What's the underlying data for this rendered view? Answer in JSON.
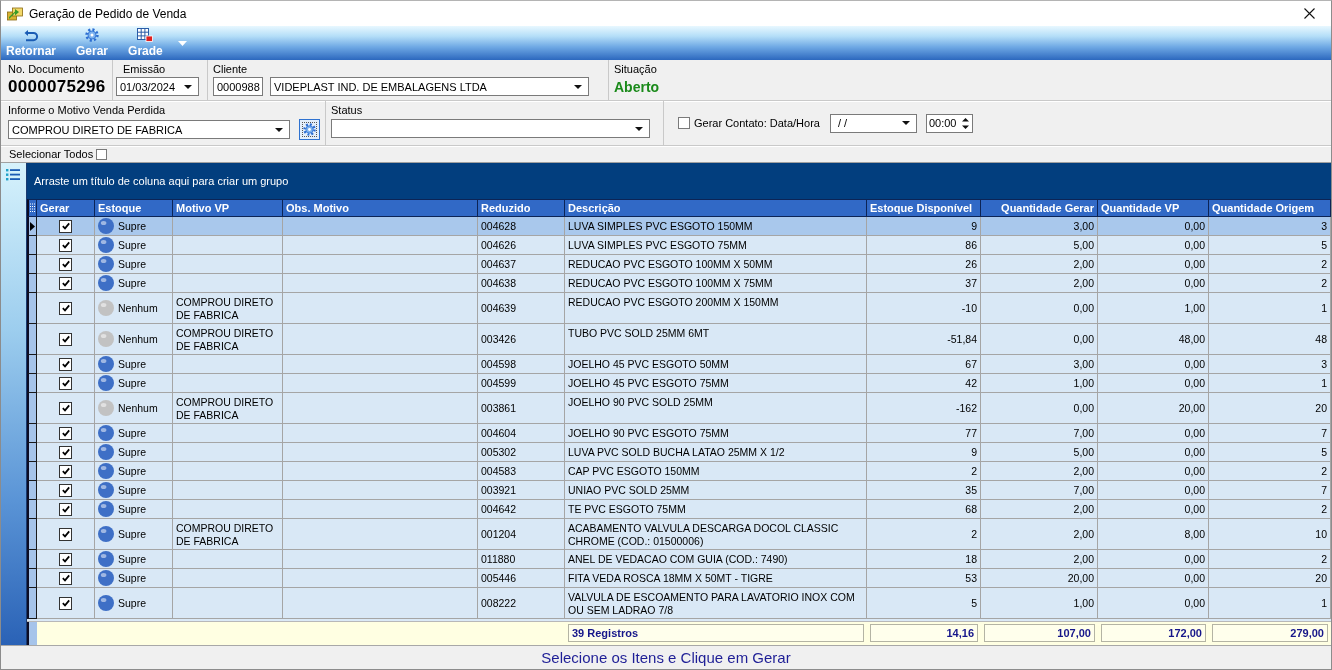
{
  "window": {
    "title": "Geração de Pedido de Venda"
  },
  "toolbar": [
    {
      "label": "Retornar"
    },
    {
      "label": "Gerar"
    },
    {
      "label": "Grade"
    }
  ],
  "header": {
    "document": {
      "label": "No. Documento",
      "value": "0000075296"
    },
    "emission": {
      "label": "Emissão",
      "value": "01/03/2024"
    },
    "client": {
      "label": "Cliente",
      "code": "0000988",
      "name": "VIDEPLAST IND. DE EMBALAGENS LTDA"
    },
    "situation": {
      "label": "Situação",
      "value": "Aberto"
    }
  },
  "filters": {
    "lost_sale_reason": {
      "label": "Informe o Motivo Venda Perdida",
      "value": "COMPROU DIRETO DE FABRICA"
    },
    "status": {
      "label": "Status"
    },
    "contact": {
      "label": "Gerar Contato: Data/Hora",
      "checked": false,
      "date": "/ /",
      "time": "00:00"
    }
  },
  "select_all": {
    "label": "Selecionar Todos",
    "checked": false
  },
  "grid": {
    "group_hint": "Arraste um título de coluna aqui para criar um grupo",
    "columns": [
      "Gerar",
      "Estoque",
      "Motivo VP",
      "Obs. Motivo",
      "Reduzido",
      "Descrição",
      "Estoque Disponível",
      "Quantidade Gerar",
      "Quantidade VP",
      "Quantidade Origem"
    ],
    "rows": [
      {
        "selected": true,
        "checked": true,
        "estoque": {
          "label": "Supre",
          "color": "#3e6fc6"
        },
        "reduzido": "004628",
        "descricao": "LUVA SIMPLES PVC ESGOTO 150MM",
        "estoque_disponivel": "9",
        "quantidade_gerar": "3,00",
        "quantidade_vp": "0,00",
        "quantidade_origem": "3"
      },
      {
        "selected": false,
        "checked": true,
        "estoque": {
          "label": "Supre",
          "color": "#3e6fc6"
        },
        "reduzido": "004626",
        "descricao": "LUVA SIMPLES PVC ESGOTO 75MM",
        "estoque_disponivel": "86",
        "quantidade_gerar": "5,00",
        "quantidade_vp": "0,00",
        "quantidade_origem": "5"
      },
      {
        "selected": false,
        "checked": true,
        "estoque": {
          "label": "Supre",
          "color": "#3e6fc6"
        },
        "reduzido": "004637",
        "descricao": "REDUCAO PVC ESGOTO 100MM X 50MM",
        "estoque_disponivel": "26",
        "quantidade_gerar": "2,00",
        "quantidade_vp": "0,00",
        "quantidade_origem": "2"
      },
      {
        "selected": false,
        "checked": true,
        "estoque": {
          "label": "Supre",
          "color": "#3e6fc6"
        },
        "reduzido": "004638",
        "descricao": "REDUCAO PVC ESGOTO 100MM X 75MM",
        "estoque_disponivel": "37",
        "quantidade_gerar": "2,00",
        "quantidade_vp": "0,00",
        "quantidade_origem": "2"
      },
      {
        "selected": false,
        "checked": true,
        "estoque": {
          "label": "Nenhum",
          "color": "#c2c2c2"
        },
        "motivo_vp": "COMPROU DIRETO DE FABRICA",
        "reduzido": "004639",
        "descricao": "REDUCAO PVC ESGOTO 200MM X 150MM",
        "estoque_disponivel": "-10",
        "quantidade_gerar": "0,00",
        "quantidade_vp": "1,00",
        "quantidade_origem": "1"
      },
      {
        "selected": false,
        "checked": true,
        "estoque": {
          "label": "Nenhum",
          "color": "#c2c2c2"
        },
        "motivo_vp": "COMPROU DIRETO DE FABRICA",
        "reduzido": "003426",
        "descricao": "TUBO PVC SOLD 25MM 6MT",
        "estoque_disponivel": "-51,84",
        "quantidade_gerar": "0,00",
        "quantidade_vp": "48,00",
        "quantidade_origem": "48"
      },
      {
        "selected": false,
        "checked": true,
        "estoque": {
          "label": "Supre",
          "color": "#3e6fc6"
        },
        "reduzido": "004598",
        "descricao": "JOELHO 45 PVC ESGOTO 50MM",
        "estoque_disponivel": "67",
        "quantidade_gerar": "3,00",
        "quantidade_vp": "0,00",
        "quantidade_origem": "3"
      },
      {
        "selected": false,
        "checked": true,
        "estoque": {
          "label": "Supre",
          "color": "#3e6fc6"
        },
        "reduzido": "004599",
        "descricao": "JOELHO 45 PVC ESGOTO 75MM",
        "estoque_disponivel": "42",
        "quantidade_gerar": "1,00",
        "quantidade_vp": "0,00",
        "quantidade_origem": "1"
      },
      {
        "selected": false,
        "checked": true,
        "estoque": {
          "label": "Nenhum",
          "color": "#c2c2c2"
        },
        "motivo_vp": "COMPROU DIRETO DE FABRICA",
        "reduzido": "003861",
        "descricao": "JOELHO 90 PVC SOLD 25MM",
        "estoque_disponivel": "-162",
        "quantidade_gerar": "0,00",
        "quantidade_vp": "20,00",
        "quantidade_origem": "20"
      },
      {
        "selected": false,
        "checked": true,
        "estoque": {
          "label": "Supre",
          "color": "#3e6fc6"
        },
        "reduzido": "004604",
        "descricao": "JOELHO 90 PVC ESGOTO 75MM",
        "estoque_disponivel": "77",
        "quantidade_gerar": "7,00",
        "quantidade_vp": "0,00",
        "quantidade_origem": "7"
      },
      {
        "selected": false,
        "checked": true,
        "estoque": {
          "label": "Supre",
          "color": "#3e6fc6"
        },
        "reduzido": "005302",
        "descricao": "LUVA PVC SOLD BUCHA LATAO 25MM X 1/2",
        "estoque_disponivel": "9",
        "quantidade_gerar": "5,00",
        "quantidade_vp": "0,00",
        "quantidade_origem": "5"
      },
      {
        "selected": false,
        "checked": true,
        "estoque": {
          "label": "Supre",
          "color": "#3e6fc6"
        },
        "reduzido": "004583",
        "descricao": "CAP PVC ESGOTO 150MM",
        "estoque_disponivel": "2",
        "quantidade_gerar": "2,00",
        "quantidade_vp": "0,00",
        "quantidade_origem": "2"
      },
      {
        "selected": false,
        "checked": true,
        "estoque": {
          "label": "Supre",
          "color": "#3e6fc6"
        },
        "reduzido": "003921",
        "descricao": "UNIAO PVC SOLD 25MM",
        "estoque_disponivel": "35",
        "quantidade_gerar": "7,00",
        "quantidade_vp": "0,00",
        "quantidade_origem": "7"
      },
      {
        "selected": false,
        "checked": true,
        "estoque": {
          "label": "Supre",
          "color": "#3e6fc6"
        },
        "reduzido": "004642",
        "descricao": "TE PVC ESGOTO 75MM",
        "estoque_disponivel": "68",
        "quantidade_gerar": "2,00",
        "quantidade_vp": "0,00",
        "quantidade_origem": "2"
      },
      {
        "selected": false,
        "checked": true,
        "estoque": {
          "label": "Supre",
          "color": "#3e6fc6"
        },
        "motivo_vp": "COMPROU DIRETO DE FABRICA",
        "reduzido": "001204",
        "descricao": "ACABAMENTO VALVULA DESCARGA DOCOL CLASSIC CHROME (COD.: 01500006)",
        "estoque_disponivel": "2",
        "quantidade_gerar": "2,00",
        "quantidade_vp": "8,00",
        "quantidade_origem": "10"
      },
      {
        "selected": false,
        "checked": true,
        "estoque": {
          "label": "Supre",
          "color": "#3e6fc6"
        },
        "reduzido": "011880",
        "descricao": "ANEL DE VEDACAO COM GUIA (COD.: 7490)",
        "estoque_disponivel": "18",
        "quantidade_gerar": "2,00",
        "quantidade_vp": "0,00",
        "quantidade_origem": "2"
      },
      {
        "selected": false,
        "checked": true,
        "estoque": {
          "label": "Supre",
          "color": "#3e6fc6"
        },
        "reduzido": "005446",
        "descricao": "FITA VEDA ROSCA 18MM X 50MT - TIGRE",
        "estoque_disponivel": "53",
        "quantidade_gerar": "20,00",
        "quantidade_vp": "0,00",
        "quantidade_origem": "20"
      },
      {
        "selected": false,
        "checked": true,
        "estoque": {
          "label": "Supre",
          "color": "#3e6fc6"
        },
        "reduzido": "008222",
        "descricao": "VALVULA DE ESCOAMENTO PARA LAVATORIO INOX COM OU SEM LADRAO 7/8",
        "estoque_disponivel": "5",
        "quantidade_gerar": "1,00",
        "quantidade_vp": "0,00",
        "quantidade_origem": "1"
      }
    ]
  },
  "footer": {
    "count": "39 Registros",
    "totals": [
      "14,16",
      "107,00",
      "172,00",
      "279,00"
    ]
  },
  "status_bar": "Selecione os Itens e Clique em Gerar"
}
